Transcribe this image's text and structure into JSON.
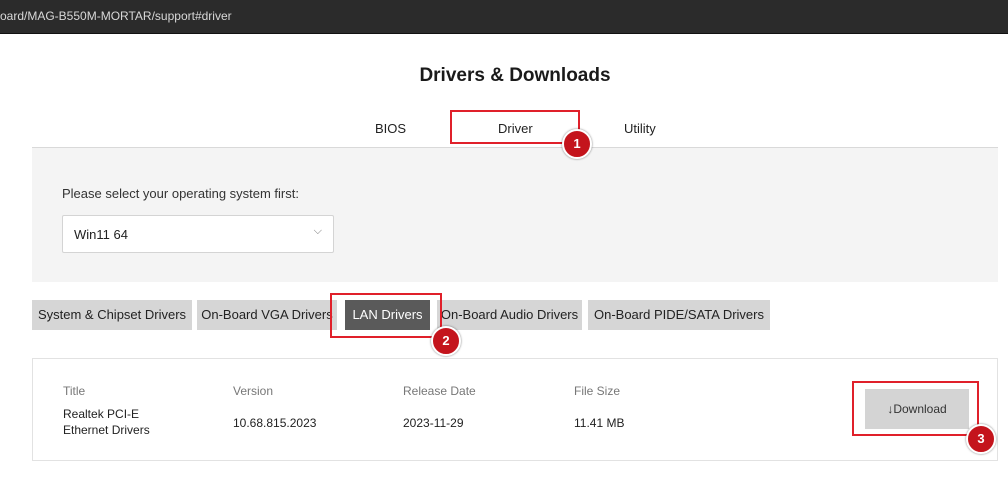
{
  "browser": {
    "url_fragment": "oard/MAG-B550M-MORTAR/support#driver"
  },
  "page": {
    "title": "Drivers & Downloads"
  },
  "tabs": [
    {
      "label": "BIOS"
    },
    {
      "label": "Driver"
    },
    {
      "label": "Utility"
    }
  ],
  "os_selector": {
    "label": "Please select your operating system first:",
    "value": "Win11 64",
    "chevron": "⌵"
  },
  "categories": [
    {
      "label": "System & Chipset Drivers"
    },
    {
      "label": "On-Board VGA Drivers"
    },
    {
      "label": "LAN Drivers"
    },
    {
      "label": "On-Board Audio Drivers"
    },
    {
      "label": "On-Board PIDE/SATA Drivers"
    }
  ],
  "driver_table": {
    "headers": {
      "title": "Title",
      "version": "Version",
      "release_date": "Release Date",
      "file_size": "File Size"
    },
    "row": {
      "title_line1": "Realtek PCI-E",
      "title_line2": "Ethernet Drivers",
      "version": "10.68.815.2023",
      "release_date": "2023-11-29",
      "file_size": "11.41 MB"
    },
    "download_label": "↓Download"
  },
  "annotations": {
    "step1": "1",
    "step2": "2",
    "step3": "3",
    "color": "#e0202a"
  }
}
